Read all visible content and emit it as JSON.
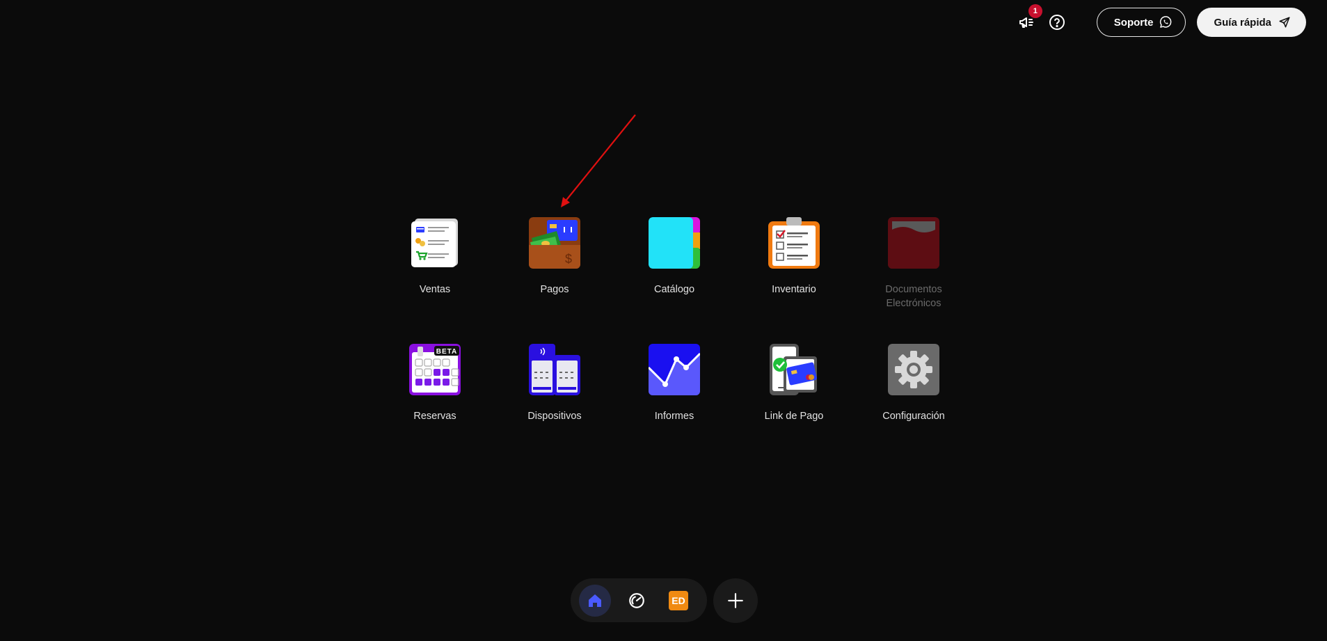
{
  "header": {
    "notification_count": "1",
    "support_label": "Soporte",
    "guide_label": "Guía rápida",
    "icons": [
      "megaphone-icon",
      "help-icon",
      "whatsapp-icon",
      "rocket-icon"
    ]
  },
  "apps": [
    {
      "label": "Ventas",
      "icon": "sales-receipt-icon",
      "enabled": true
    },
    {
      "label": "Pagos",
      "icon": "wallet-icon",
      "enabled": true
    },
    {
      "label": "Catálogo",
      "icon": "catalog-icon",
      "enabled": true
    },
    {
      "label": "Inventario",
      "icon": "clipboard-checklist-icon",
      "enabled": true
    },
    {
      "label": "Documentos Electrónicos",
      "icon": "document-folder-icon",
      "enabled": false
    },
    {
      "label": "Reservas",
      "icon": "calendar-icon",
      "enabled": true,
      "badge": "BETA"
    },
    {
      "label": "Dispositivos",
      "icon": "pos-device-icon",
      "enabled": true
    },
    {
      "label": "Informes",
      "icon": "line-chart-icon",
      "enabled": true
    },
    {
      "label": "Link de Pago",
      "icon": "phone-card-icon",
      "enabled": true
    },
    {
      "label": "Configuración",
      "icon": "gear-icon",
      "enabled": true
    }
  ],
  "dock": {
    "items": [
      "home-icon",
      "speedometer-icon",
      "avatar"
    ],
    "avatar_initials": "ED",
    "add_icon": "plus-icon"
  },
  "colors": {
    "background": "#0b0b0b",
    "accent_blue": "#3d4bff",
    "badge_red": "#c8102e",
    "avatar_orange": "#f08a12"
  }
}
